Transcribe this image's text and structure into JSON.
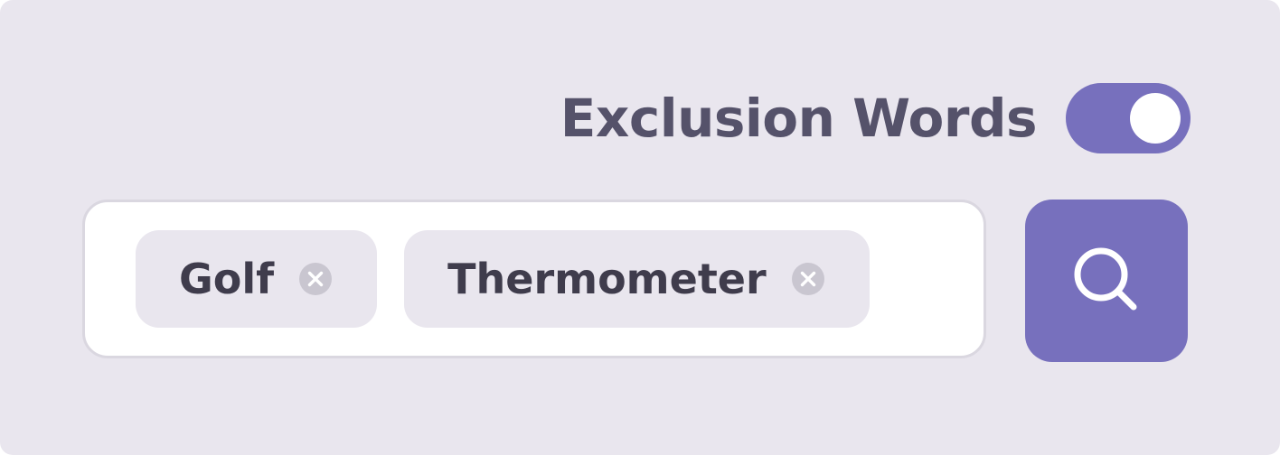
{
  "exclusion_toggle": {
    "label": "Exclusion Words",
    "state": "on",
    "color": "#7770bd"
  },
  "search": {
    "chips": [
      {
        "label": "Golf",
        "remove_icon": "close-circle-icon"
      },
      {
        "label": "Thermometer",
        "remove_icon": "close-circle-icon"
      }
    ],
    "button_icon": "search-icon"
  },
  "colors": {
    "background": "#e9e6ee",
    "accent": "#7770bd",
    "label_text": "#55526a",
    "chip_text": "#3f3c4c"
  }
}
